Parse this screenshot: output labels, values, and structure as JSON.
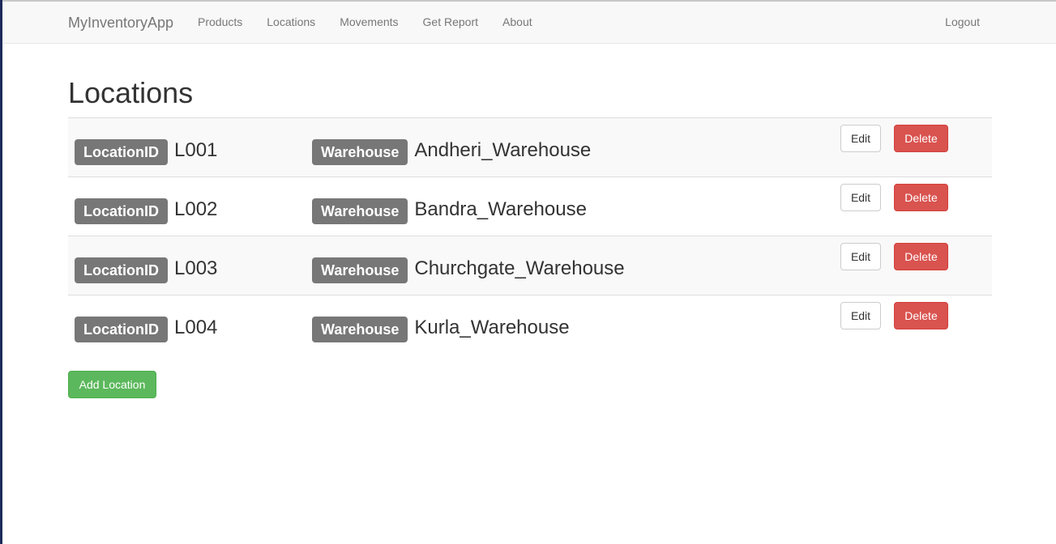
{
  "navbar": {
    "brand": "MyInventoryApp",
    "links": [
      {
        "label": "Products"
      },
      {
        "label": "Locations"
      },
      {
        "label": "Movements"
      },
      {
        "label": "Get Report"
      },
      {
        "label": "About"
      }
    ],
    "logout_label": "Logout"
  },
  "main": {
    "title": "Locations",
    "id_badge_label": "LocationID",
    "warehouse_badge_label": "Warehouse",
    "rows": [
      {
        "location_id": "L001",
        "warehouse": "Andheri_Warehouse"
      },
      {
        "location_id": "L002",
        "warehouse": "Bandra_Warehouse"
      },
      {
        "location_id": "L003",
        "warehouse": "Churchgate_Warehouse"
      },
      {
        "location_id": "L004",
        "warehouse": "Kurla_Warehouse"
      }
    ],
    "edit_label": "Edit",
    "delete_label": "Delete",
    "add_label": "Add Location"
  },
  "colors": {
    "badge": "#777777",
    "delete": "#d9534f",
    "add": "#5cb85c",
    "navbar_bg": "#f8f8f8"
  }
}
